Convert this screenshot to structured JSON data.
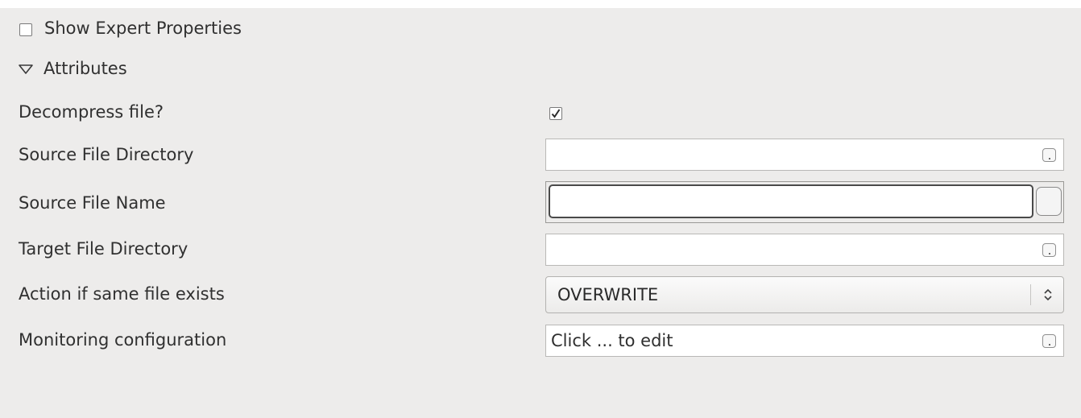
{
  "expert": {
    "label": "Show Expert Properties",
    "checked": false
  },
  "section": {
    "label": "Attributes",
    "expanded": true
  },
  "properties": {
    "decompress": {
      "label": "Decompress file?",
      "checked": true
    },
    "source_dir": {
      "label": "Source File Directory",
      "value": ""
    },
    "source_name": {
      "label": "Source File Name",
      "value": ""
    },
    "target_dir": {
      "label": "Target File Directory",
      "value": ""
    },
    "action": {
      "label": "Action if same file exists",
      "value": "OVERWRITE"
    },
    "monitoring": {
      "label": "Monitoring configuration",
      "value": "Click ... to edit"
    }
  }
}
